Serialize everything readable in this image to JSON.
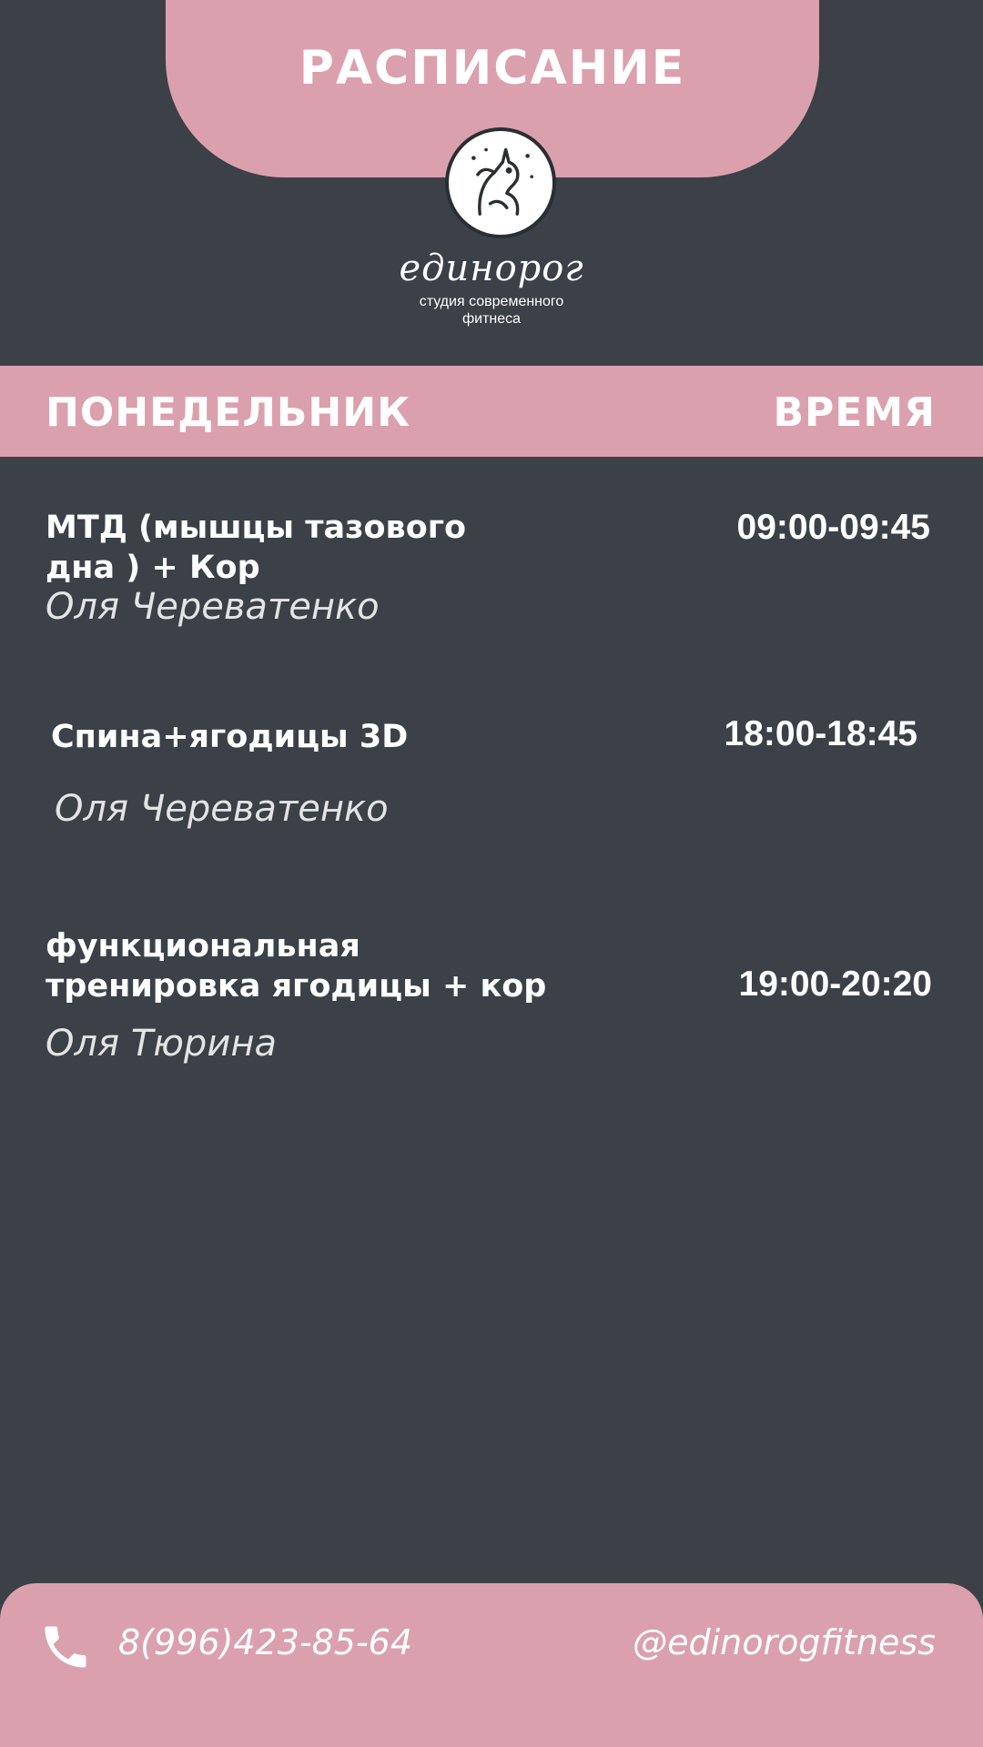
{
  "header": {
    "title": "РАСПИСАНИЕ"
  },
  "brand": {
    "logo_icon": "unicorn-logo-icon",
    "name": "единорог",
    "subtitle_line1": "студия современного",
    "subtitle_line2": "фитнеса"
  },
  "day_bar": {
    "day": "ПОНЕДЕЛЬНИК",
    "time_header": "ВРЕМЯ"
  },
  "classes": [
    {
      "title_line1": "МТД (мышцы тазового",
      "title_line2": "дна ) + Кор",
      "trainer": "Оля Череватенко",
      "time": "09:00-09:45"
    },
    {
      "title_line1": "Спина+ягодицы 3D",
      "title_line2": "",
      "trainer": "Оля Череватенко",
      "time": "18:00-18:45"
    },
    {
      "title_line1": "функциональная",
      "title_line2": "тренировка ягодицы + кор",
      "trainer": "Оля Тюрина",
      "time": "19:00-20:20"
    }
  ],
  "footer": {
    "phone_icon": "phone-icon",
    "phone": "8(996)423-85-64",
    "handle": "@edinorogfitness"
  },
  "colors": {
    "background": "#3b4147",
    "accent_pink": "#dba0ae",
    "text": "#ffffff"
  }
}
